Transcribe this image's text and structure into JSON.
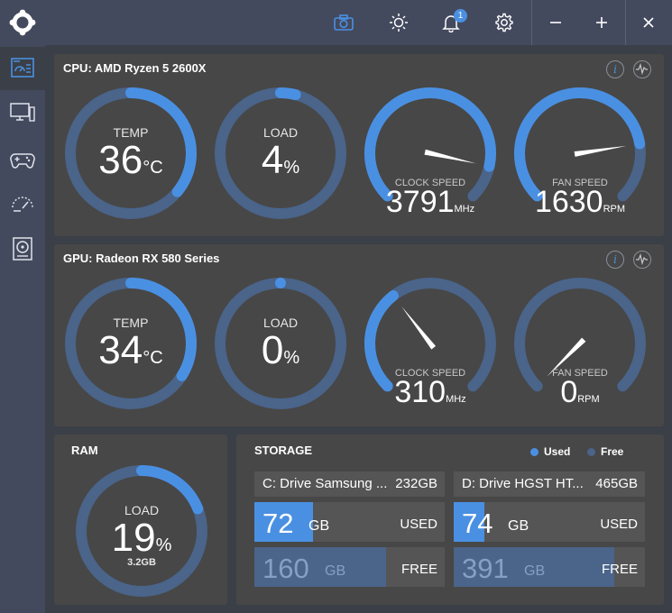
{
  "titlebar": {
    "notification_count": "1",
    "icons": [
      "app-logo-icon",
      "camera-icon",
      "brightness-icon",
      "bell-icon",
      "gear-icon",
      "minimize-icon",
      "maximize-icon",
      "close-icon"
    ]
  },
  "sidebar": {
    "items": [
      {
        "icon": "monitor-dashboard-icon",
        "active": true
      },
      {
        "icon": "computer-icon",
        "active": false
      },
      {
        "icon": "gamepad-icon",
        "active": false
      },
      {
        "icon": "speedometer-icon",
        "active": false
      },
      {
        "icon": "storage-drive-icon",
        "active": false
      }
    ]
  },
  "colors": {
    "accent": "#4a90e2",
    "track": "#4a648a",
    "panel": "#474747",
    "background": "#3b3f47",
    "bar_bg": "#555555"
  },
  "cpu": {
    "prefix": "CPU:",
    "name": "AMD Ryzen 5 2600X",
    "temp": {
      "label": "TEMP",
      "value": "36",
      "unit": "°C",
      "fraction": 0.36
    },
    "load": {
      "label": "LOAD",
      "value": "4",
      "unit": "%",
      "fraction": 0.04
    },
    "clock": {
      "label": "CLOCK SPEED",
      "value": "3791",
      "unit": "MHz",
      "fraction": 0.88
    },
    "fan": {
      "label": "FAN SPEED",
      "value": "1630",
      "unit": "RPM",
      "fraction": 0.8
    }
  },
  "gpu": {
    "prefix": "GPU:",
    "name": "Radeon RX 580 Series",
    "temp": {
      "label": "TEMP",
      "value": "34",
      "unit": "°C",
      "fraction": 0.34
    },
    "load": {
      "label": "LOAD",
      "value": "0",
      "unit": "%",
      "fraction": 0.0
    },
    "clock": {
      "label": "CLOCK SPEED",
      "value": "310",
      "unit": "MHz",
      "fraction": 0.36
    },
    "fan": {
      "label": "FAN SPEED",
      "value": "0",
      "unit": "RPM",
      "fraction": 0.0
    }
  },
  "ram": {
    "title": "RAM",
    "label": "LOAD",
    "value": "19",
    "unit": "%",
    "used": "3.2GB",
    "fraction": 0.19
  },
  "storage": {
    "title": "STORAGE",
    "legend_used": "Used",
    "legend_free": "Free",
    "drives": [
      {
        "name": "C: Drive Samsung ...",
        "size": "232GB",
        "used": "72",
        "free": "160",
        "unit": "GB",
        "used_label": "USED",
        "free_label": "FREE",
        "used_fraction": 0.31,
        "free_fraction": 0.69
      },
      {
        "name": "D: Drive HGST HT...",
        "size": "465GB",
        "used": "74",
        "free": "391",
        "unit": "GB",
        "used_label": "USED",
        "free_label": "FREE",
        "used_fraction": 0.16,
        "free_fraction": 0.84
      }
    ]
  }
}
